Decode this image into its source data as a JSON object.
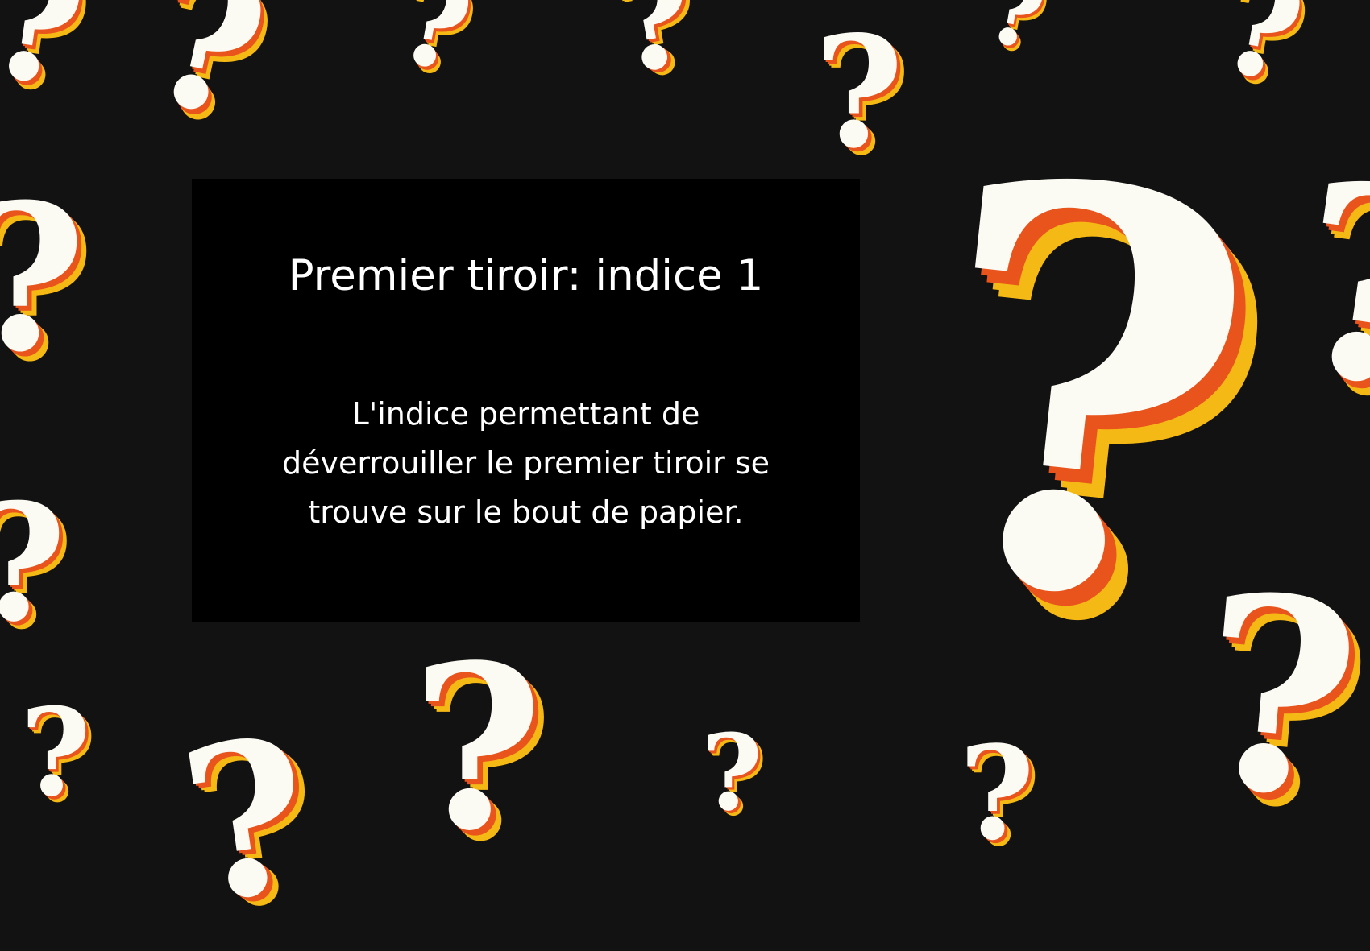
{
  "background": {
    "color": "#121212",
    "decoration_glyph": "?",
    "accent_colors": [
      "#fbfaf3",
      "#e8541c",
      "#f5b915"
    ]
  },
  "card": {
    "title": "Premier tiroir: indice 1",
    "body_lines": [
      "L'indice permettant de",
      "déverrouiller le premier tiroir se",
      "trouve sur le bout de papier."
    ]
  }
}
